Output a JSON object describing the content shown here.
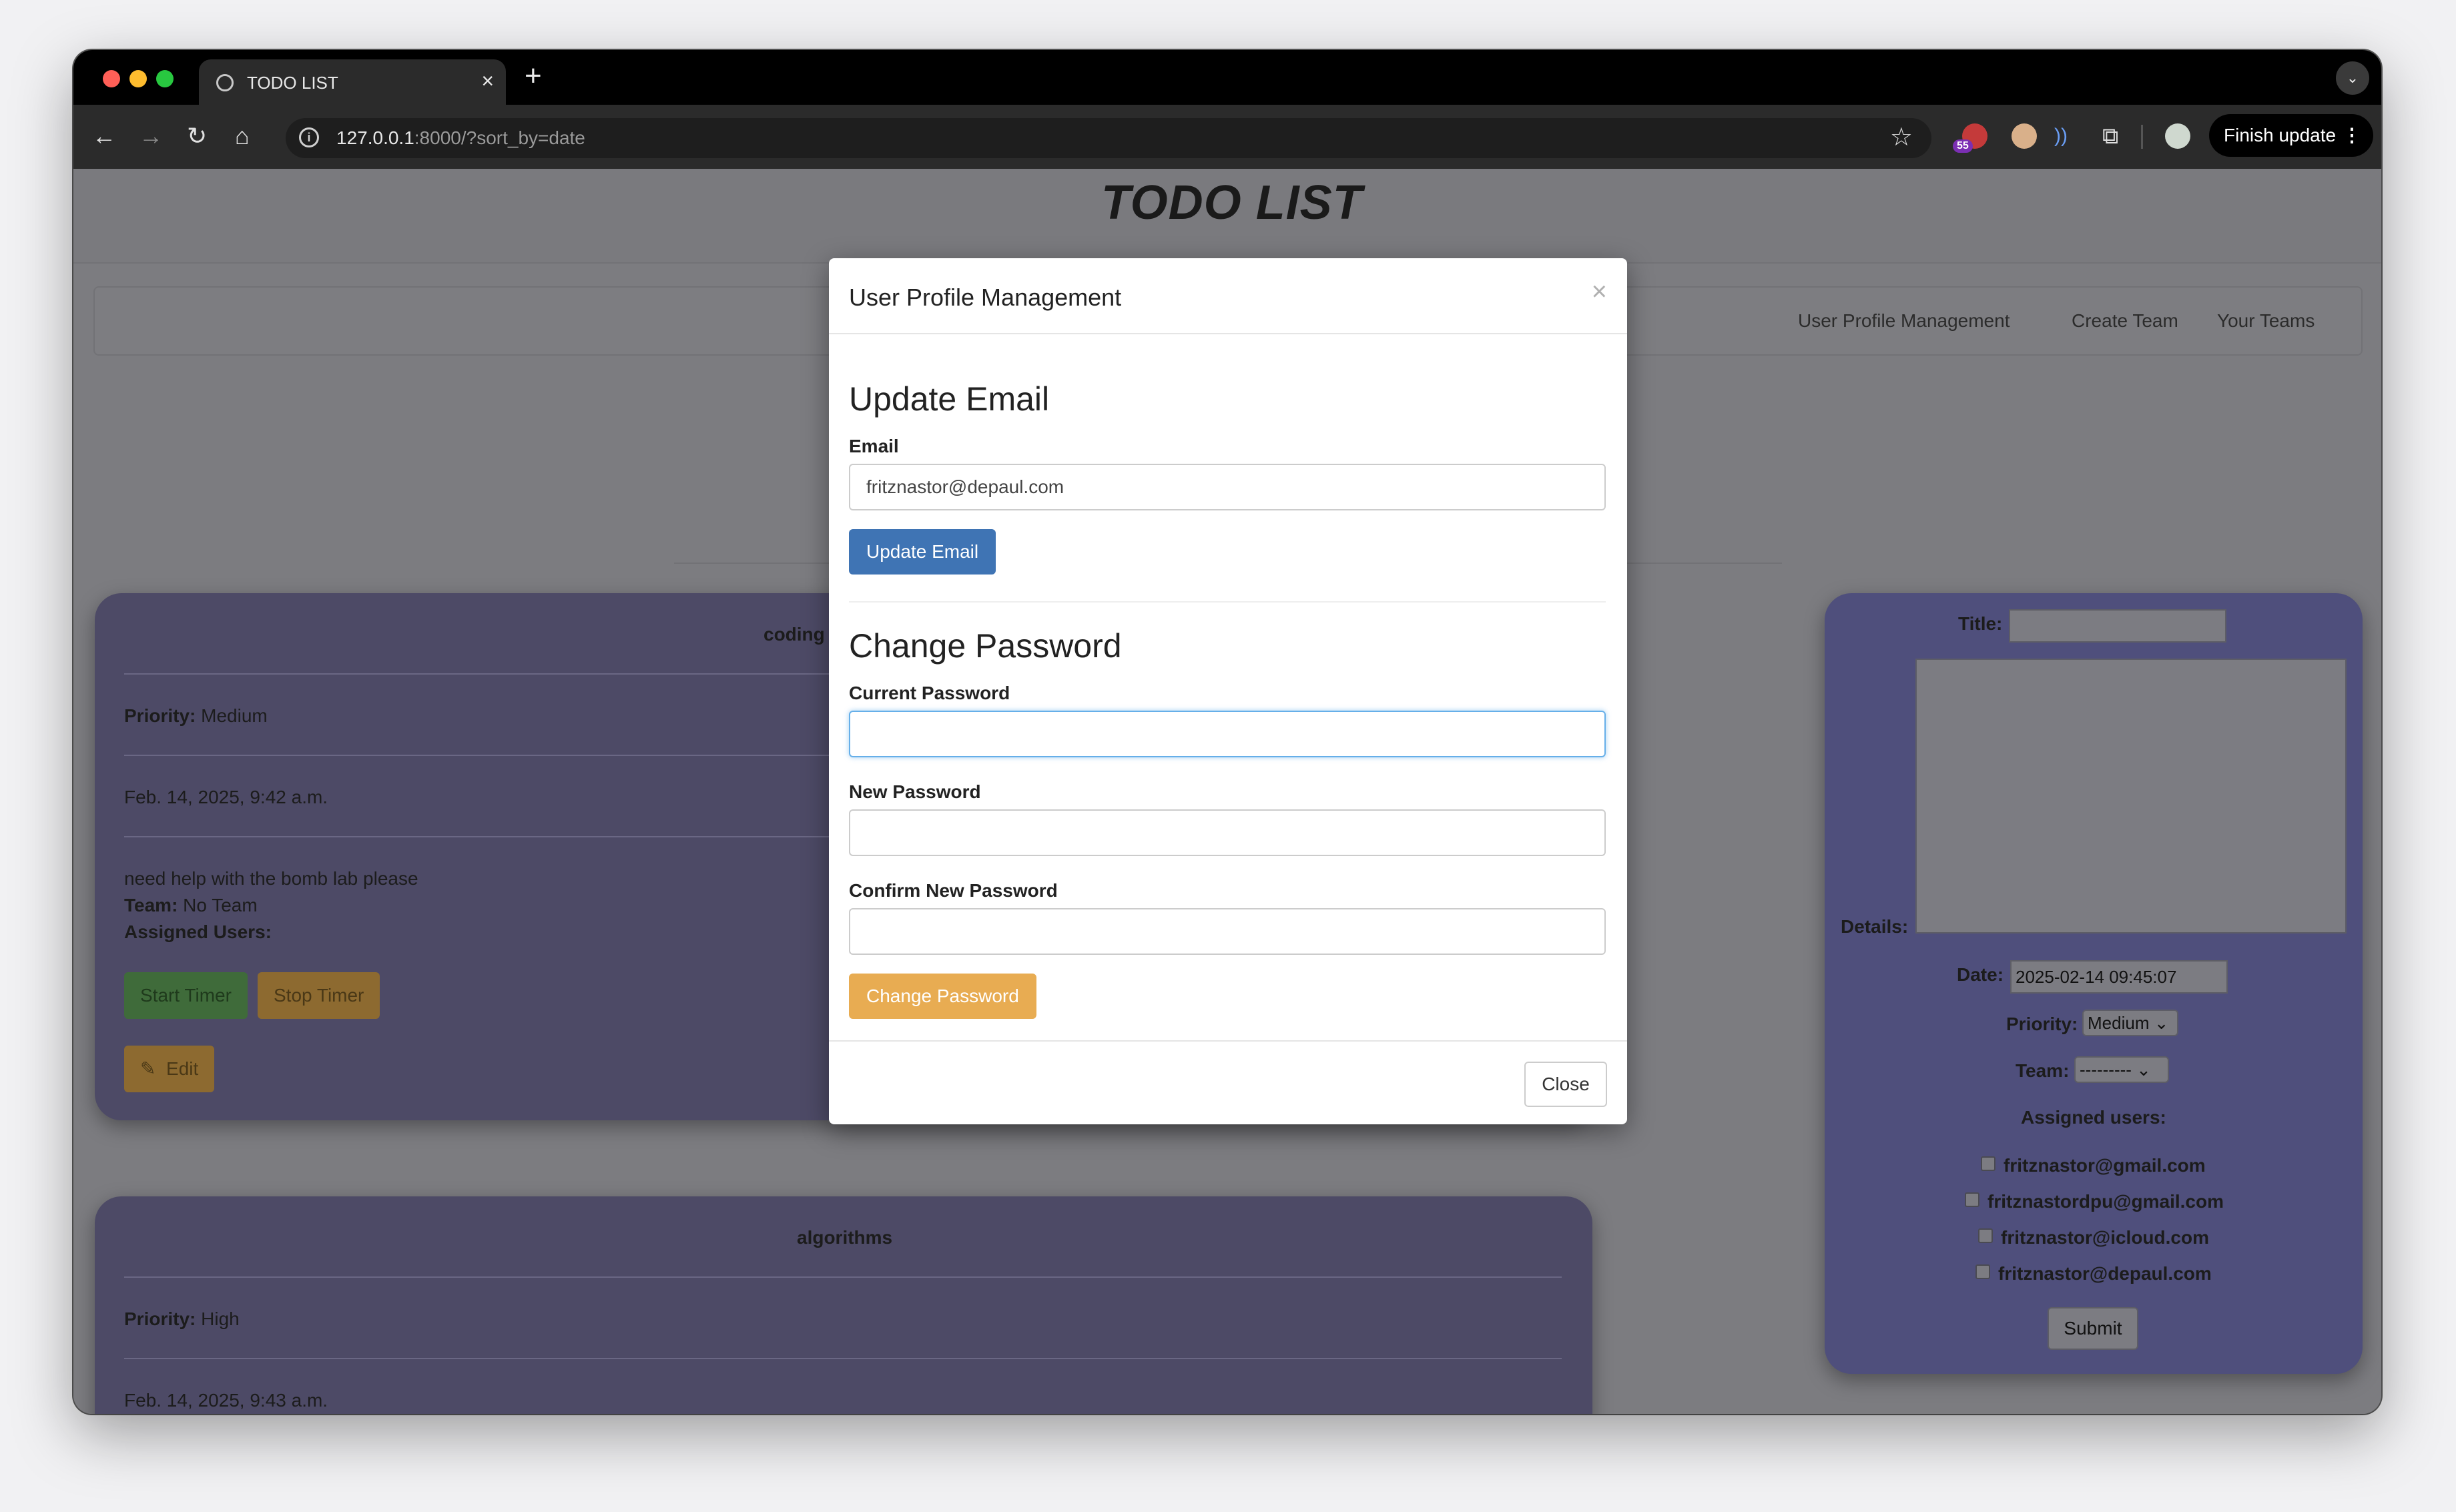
{
  "browser": {
    "tab_title": "TODO LIST",
    "tab_close": "×",
    "new_tab": "+",
    "url_host": "127.0.0.1",
    "url_rest": ":8000/?sort_by=date",
    "extension_badge": "55",
    "finish_update": "Finish update",
    "finish_menu": "⋮"
  },
  "page": {
    "title": "TODO LIST",
    "nav": [
      "User Profile Management",
      "Create Team",
      "Your Teams"
    ]
  },
  "tasks": [
    {
      "title": "coding",
      "priority_label": "Priority:",
      "priority": "Medium",
      "date": "Feb. 14, 2025, 9:42 a.m.",
      "description": "need help with the bomb lab please",
      "team_label": "Team:",
      "team": "No Team",
      "assigned_label": "Assigned Users:",
      "start_timer": "Start Timer",
      "stop_timer": "Stop Timer",
      "edit": "Edit"
    },
    {
      "title": "algorithms",
      "priority_label": "Priority:",
      "priority": "High",
      "date": "Feb. 14, 2025, 9:43 a.m."
    }
  ],
  "form": {
    "title_label": "Title:",
    "details_label": "Details:",
    "date_label": "Date:",
    "date_value": "2025-02-14 09:45:07",
    "priority_label": "Priority:",
    "priority_value": "Medium",
    "team_label": "Team:",
    "team_value": "---------",
    "assigned_label": "Assigned users:",
    "users": [
      "fritznastor@gmail.com",
      "fritznastordpu@gmail.com",
      "fritznastor@icloud.com",
      "fritznastor@depaul.com"
    ],
    "submit": "Submit"
  },
  "modal": {
    "title": "User Profile Management",
    "close_x": "×",
    "update_email_heading": "Update Email",
    "email_label": "Email",
    "email_value": "fritznastor@depaul.com",
    "update_email_button": "Update Email",
    "change_password_heading": "Change Password",
    "current_password_label": "Current Password",
    "new_password_label": "New Password",
    "confirm_password_label": "Confirm New Password",
    "change_password_button": "Change Password",
    "close_button": "Close"
  },
  "colors": {
    "primary_button": "#3f74b4",
    "warning_button": "#e8ac52",
    "card_bg": "#4d4a66",
    "start_timer": "#3f6b3a",
    "stop_timer": "#8d6a30"
  }
}
